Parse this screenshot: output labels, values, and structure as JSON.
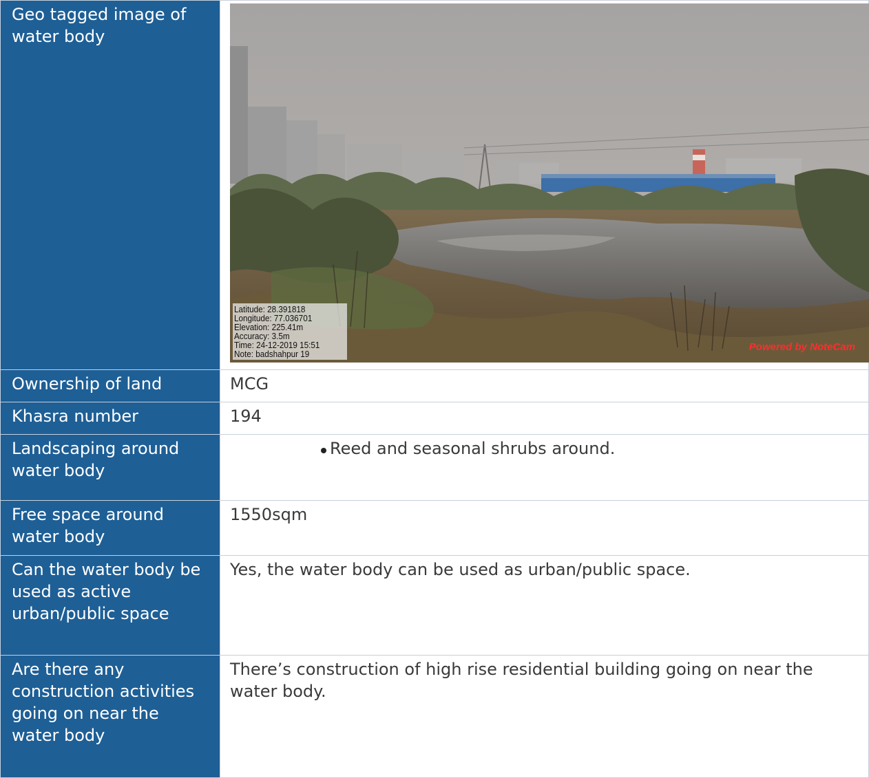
{
  "rows": {
    "photo": {
      "label": "Geo tagged image of water body",
      "stamp": {
        "latitude": "Latitude: 28.391818",
        "longitude": "Longitude: 77.036701",
        "elevation": "Elevation: 225.41m",
        "accuracy": "Accuracy: 3.5m",
        "time": "Time: 24-12-2019 15:51",
        "note": "Note: badshahpur 19"
      },
      "brand": "Powered by NoteCam"
    },
    "ownership": {
      "label": "Ownership of land",
      "value": "MCG"
    },
    "khasra": {
      "label": "Khasra number",
      "value": "194"
    },
    "landscaping": {
      "label": "Landscaping around water body",
      "bullet": "Reed and seasonal shrubs around."
    },
    "free_space": {
      "label": "Free space around water body",
      "value": "1550sqm"
    },
    "public_space": {
      "label": "Can the water body be used as active urban/public space",
      "value": "Yes, the water body can be used as urban/public space."
    },
    "construction": {
      "label": "Are there any construction activities going on near the water body",
      "value": "There’s construction of high rise residential building going on near the water body."
    }
  },
  "colors": {
    "label_bg": "#1e5f96",
    "label_text": "#ffffff",
    "value_text": "#3a3a3a",
    "brand_text": "#ff2d2d"
  }
}
